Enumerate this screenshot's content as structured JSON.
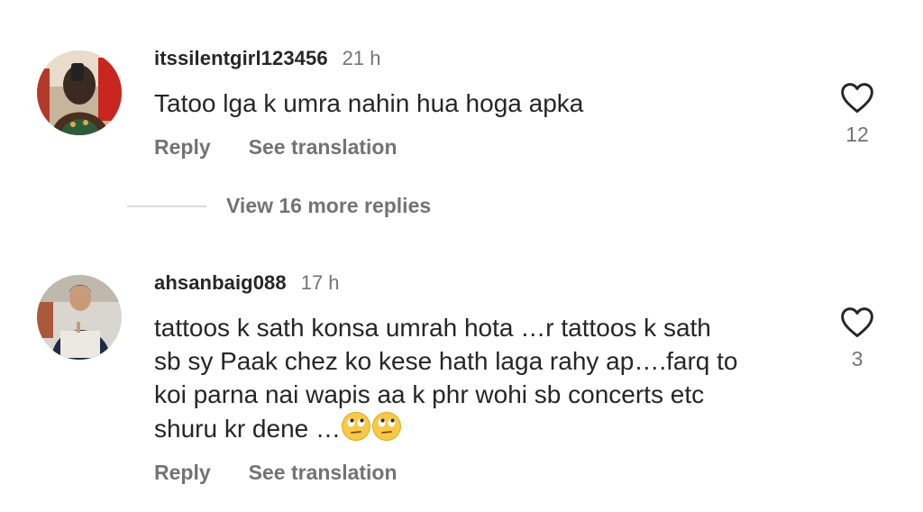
{
  "comments": [
    {
      "username": "itssilentgirl123456",
      "time": "21 h",
      "text": "Tatoo lga k umra nahin hua hoga apka",
      "reply_label": "Reply",
      "translate_label": "See translation",
      "like_count": "12"
    },
    {
      "username": "ahsanbaig088",
      "time": "17 h",
      "text_lines": [
        "tattoos k sath konsa umrah hota …r tattoos k sath",
        "sb sy Paak chez ko kese hath laga rahy ap….farq to",
        "koi parna nai wapis aa k phr wohi sb concerts etc",
        "shuru kr dene …"
      ],
      "reply_label": "Reply",
      "translate_label": "See translation",
      "like_count": "3"
    }
  ],
  "view_more_replies": "View 16 more replies",
  "icons": {
    "like": "heart-outline-icon",
    "emoji": "face-with-rolling-eyes-emoji"
  },
  "colors": {
    "text": "#262626",
    "secondary": "#737373",
    "divider": "#dbdbdb"
  }
}
